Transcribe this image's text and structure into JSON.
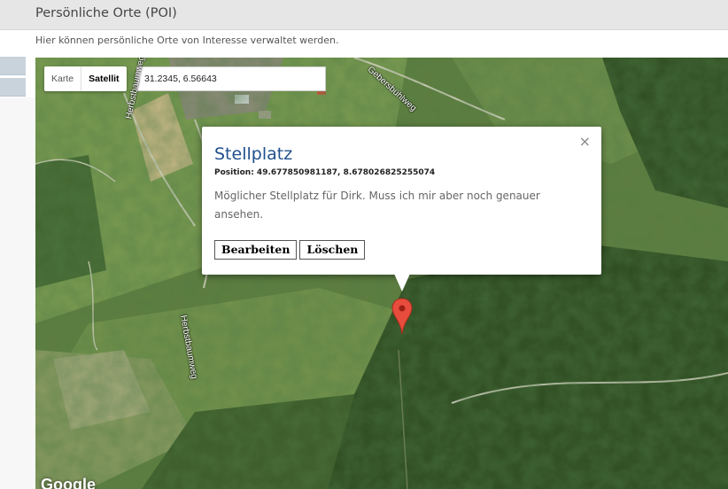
{
  "page": {
    "title": "Persönliche Orte (POI)",
    "subtitle": "Hier können persönliche Orte von Interesse verwaltet werden."
  },
  "map": {
    "type_control": {
      "map_label": "Karte",
      "satellite_label": "Satellit",
      "active": "Satellit"
    },
    "coordinate_input": {
      "value": "31.2345, 6.56643"
    },
    "street_labels": [
      "Herbstbaumweg",
      "Herbstbaumweg",
      "Gebersbühlweg"
    ],
    "attribution": "Google",
    "marker": {
      "icon": "map-pin-icon",
      "color": "#e74c3c"
    }
  },
  "infowindow": {
    "title": "Stellplatz",
    "position_text": "Position: 49.677850981187, 8.678026825255074",
    "description": "Möglicher Stellplatz für Dirk. Muss ich mir aber noch genauer ansehen.",
    "edit_label": "Bearbeiten",
    "delete_label": "Löschen",
    "close_label": "×",
    "title_color": "#1f4f8e"
  }
}
